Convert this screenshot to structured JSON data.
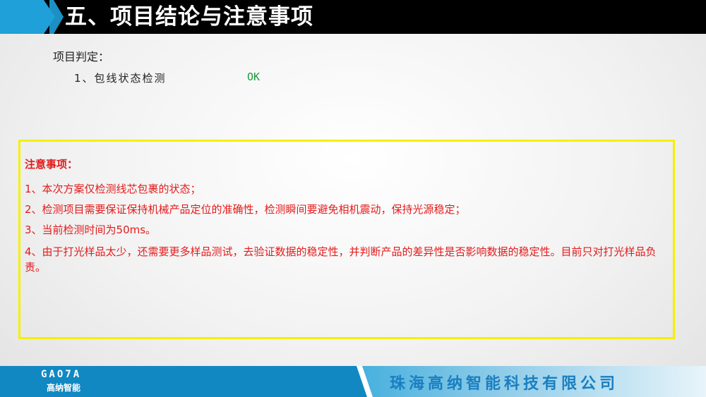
{
  "header": {
    "title": "五、项目结论与注意事项"
  },
  "verdict": {
    "heading": "项目判定：",
    "items": [
      {
        "label": "1、包线状态检测",
        "result": "OK"
      }
    ]
  },
  "notes": {
    "title": "注意事项：",
    "items": [
      "1、本次方案仅检测线芯包裹的状态；",
      "2、检测项目需要保证保持机械产品定位的准确性，检测瞬间要避免相机震动，保持光源稳定；",
      "3、当前检测时间为50ms。",
      "4、由于打光样品太少，还需要更多样品测试，去验证数据的稳定性，并判断产品的差异性是否影响数据的稳定性。目前只对打光样品负责。"
    ]
  },
  "footer": {
    "logo_text": "GAO7A",
    "logo_cn": "高纳智能",
    "company": "珠海高纳智能科技有限公司"
  },
  "colors": {
    "accent": "#1fa0d8",
    "note_text": "#e31b1b",
    "ok": "#1a9b3a",
    "box_border": "#f5f000"
  }
}
